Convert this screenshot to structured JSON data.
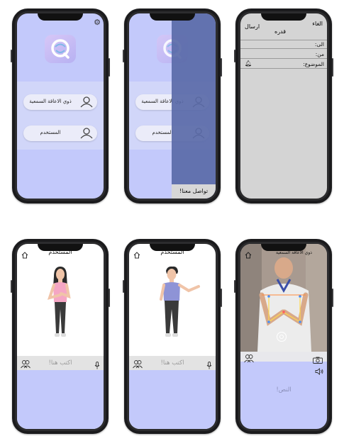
{
  "screen1": {
    "buttons": [
      "ذوي الاعاقة السمعية",
      "المستخدم"
    ],
    "icons": [
      "gear-icon",
      "app-logo",
      "user-icon"
    ]
  },
  "screen2": {
    "buttons": [
      "ذوي الاعاقة السمعية",
      "المستخدم"
    ],
    "contact_label": "تواصل معنا!"
  },
  "screen3": {
    "cancel": "الغاء",
    "send": "ارسال",
    "name": "قدره",
    "to": "الى:",
    "from": "من:",
    "subject": "الموضوع:",
    "icons": [
      "bell-icon"
    ]
  },
  "screen4": {
    "title": "المستخدم",
    "placeholder": "اكتب هنا!",
    "icons": [
      "home-icon",
      "group-icon",
      "mic-icon"
    ]
  },
  "screen5": {
    "title": "المستخدم",
    "placeholder": "اكتب هنا!",
    "icons": [
      "home-icon",
      "group-icon",
      "mic-icon"
    ]
  },
  "screen6": {
    "title": "ذوي الاعاقة السمعية",
    "result_label": "النص!",
    "icons": [
      "home-icon",
      "group-icon",
      "camera-icon",
      "speaker-icon",
      "capture-icon"
    ]
  },
  "colors": {
    "lavender": "#c3c9fb",
    "overlay": "#5a6aa8",
    "gray": "#d4d4d4"
  }
}
